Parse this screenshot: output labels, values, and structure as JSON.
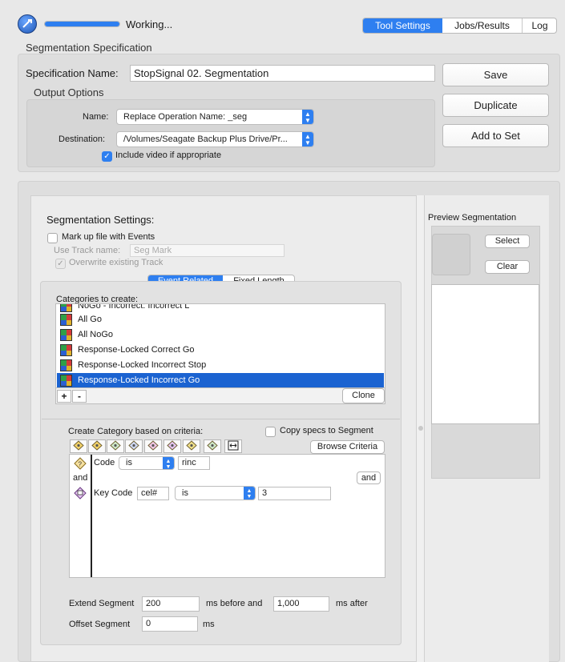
{
  "status": {
    "text": "Working...",
    "progress": 1.0
  },
  "tabs": [
    "Tool Settings",
    "Jobs/Results",
    "Log"
  ],
  "spec": {
    "section_title": "Segmentation Specification",
    "name_label": "Specification Name:",
    "name_value": "StopSignal 02. Segmentation",
    "save": "Save",
    "duplicate": "Duplicate",
    "add_to_set": "Add to Set"
  },
  "output": {
    "title": "Output Options",
    "name_label": "Name:",
    "name_value": "Replace Operation Name: _seg",
    "dest_label": "Destination:",
    "dest_value": "/Volumes/Seagate Backup Plus Drive/Pr...",
    "include_video": "Include video if appropriate"
  },
  "seg": {
    "title": "Segmentation Settings:",
    "markup": "Mark up file with Events",
    "use_track": "Use Track name:",
    "track_placeholder": "Seg Mark",
    "overwrite": "Overwrite existing Track",
    "mode_tabs": [
      "Event Related",
      "Fixed Length"
    ],
    "categories_label": "Categories to create:",
    "categories": [
      "NoGo - Incorrect: Incorrect L",
      "All Go",
      "All NoGo",
      "Response-Locked Correct Go",
      "Response-Locked Incorrect Stop",
      "Response-Locked Incorrect Go"
    ],
    "add": "+",
    "remove": "-",
    "clone": "Clone"
  },
  "criteria": {
    "label": "Create Category based on criteria:",
    "copy_specs": "Copy specs to Segment",
    "browse": "Browse Criteria",
    "and_label": "and",
    "and_button": "and",
    "rows": [
      {
        "field": "Code",
        "op": "is",
        "value": "rinc"
      },
      {
        "field": "Key Code",
        "key": "cel#",
        "op": "is",
        "value": "3"
      }
    ]
  },
  "extend": {
    "label": "Extend Segment",
    "before": "200",
    "before_unit": "ms before and",
    "after": "1,000",
    "after_unit": "ms after",
    "offset_label": "Offset Segment",
    "offset": "0",
    "offset_unit": "ms"
  },
  "preview": {
    "title": "Preview Segmentation",
    "select": "Select",
    "clear": "Clear"
  },
  "colors": {
    "accent": "#2e7ff0",
    "selection": "#1b63d1"
  }
}
